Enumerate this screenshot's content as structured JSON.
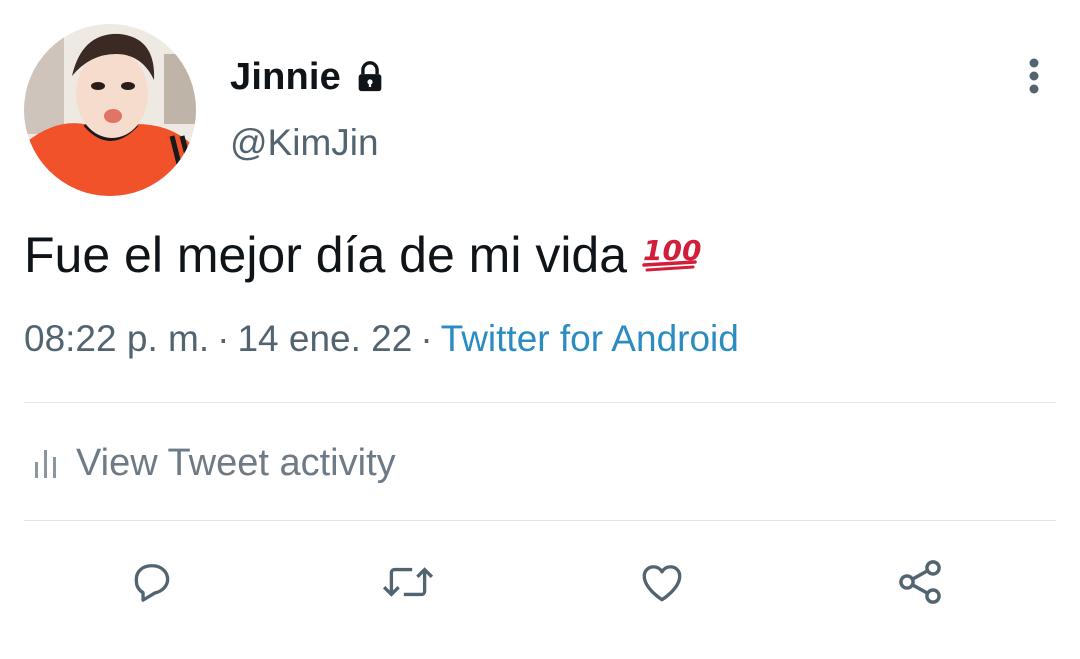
{
  "tweet": {
    "author": {
      "display_name": "Jinnie",
      "handle": "@KimJin",
      "protected_icon": "lock-icon"
    },
    "text": "Fue el mejor día de mi vida",
    "emoji": "💯",
    "meta": {
      "time": "08:22 p. m.",
      "separator_1": "·",
      "date": "14 ene. 22",
      "separator_2": "·",
      "source": "Twitter for Android"
    },
    "activity_label": "View Tweet activity",
    "actions": {
      "reply_icon": "reply-icon",
      "retweet_icon": "retweet-icon",
      "like_icon": "heart-icon",
      "share_icon": "share-icon"
    },
    "more_icon": "more-vertical-icon"
  },
  "colors": {
    "text_primary": "#0f1419",
    "text_secondary": "#536471",
    "link": "#2b8cc4",
    "emoji_red": "#d11f3a",
    "icon_gray": "#536471",
    "divider": "#e1e5e8"
  }
}
